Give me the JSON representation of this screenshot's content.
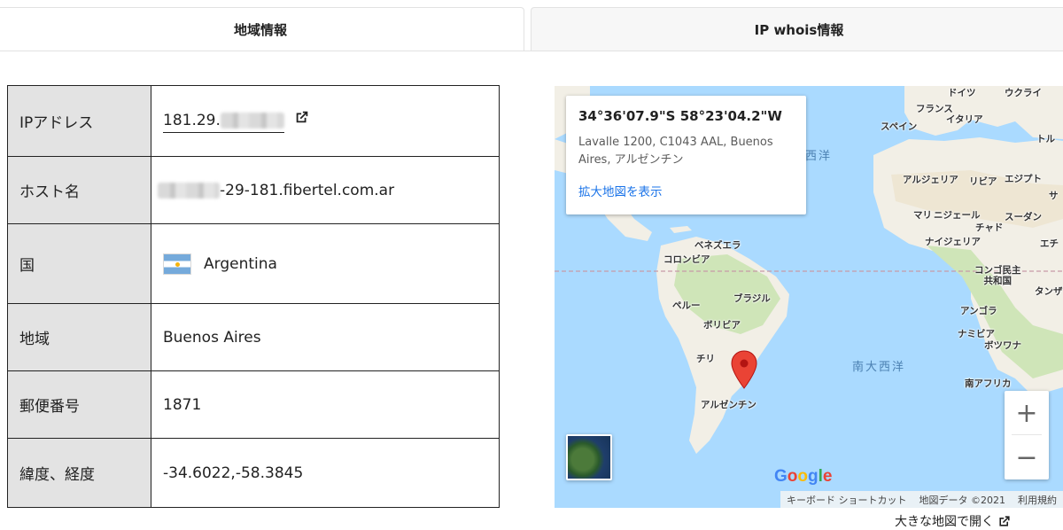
{
  "tabs": {
    "region": "地域情報",
    "whois": "IP whois情報"
  },
  "table": {
    "ip_label": "IPアドレス",
    "ip_value": "181.29.",
    "host_label": "ホスト名",
    "host_value": "-29-181.fibertel.com.ar",
    "country_label": "国",
    "country_value": "Argentina",
    "region_label": "地域",
    "region_value": "Buenos Aires",
    "zip_label": "郵便番号",
    "zip_value": "1871",
    "latlng_label": "緯度、経度",
    "latlng_value": "-34.6022,-58.3845"
  },
  "map": {
    "card_coords": "34°36'07.9\"S 58°23'04.2\"W",
    "card_address": "Lavalle 1200, C1043 AAL, Buenos Aires, アルゼンチン",
    "card_link": "拡大地図を表示",
    "labels": {
      "germany": "ドイツ",
      "ukraine": "ウクライ",
      "france": "フランス",
      "italy": "イタリア",
      "spain": "スペイン",
      "turkey": "トル",
      "algeria": "アルジェリア",
      "libya": "リビア",
      "egypt": "エジプト",
      "sa": "サ",
      "mali": "マリ",
      "niger": "ニジェール",
      "chad": "チャド",
      "sudan": "スーダン",
      "nigeria": "ナイジェリア",
      "ethiopia": "エチ",
      "venezuela": "ベネズエラ",
      "colombia": "コロンビア",
      "drc": "コンゴ民主\n共和国",
      "tanzania": "タンザ",
      "brazil": "ブラジル",
      "peru": "ペルー",
      "bolivia": "ボリビア",
      "angola": "アンゴラ",
      "namibia": "ナミビア",
      "botswana": "ボツワナ",
      "chile": "チリ",
      "argentina": "アルゼンチン",
      "south_africa": "南アフリカ",
      "atlantic_north": "西洋",
      "atlantic_south": "南大西洋"
    },
    "google": "Google",
    "attr_shortcuts": "キーボード ショートカット",
    "attr_data": "地図データ ©2021",
    "attr_terms": "利用規約",
    "zoom_in": "+",
    "zoom_out": "−",
    "open_larger": "大きな地図で開く"
  },
  "colors": {
    "ocean": "#aadaff",
    "land": "#f2efe6",
    "land_green": "#cfe5b8",
    "marker": "#ea4335",
    "link": "#1a73e8",
    "header_cell": "#e3e3e3"
  }
}
